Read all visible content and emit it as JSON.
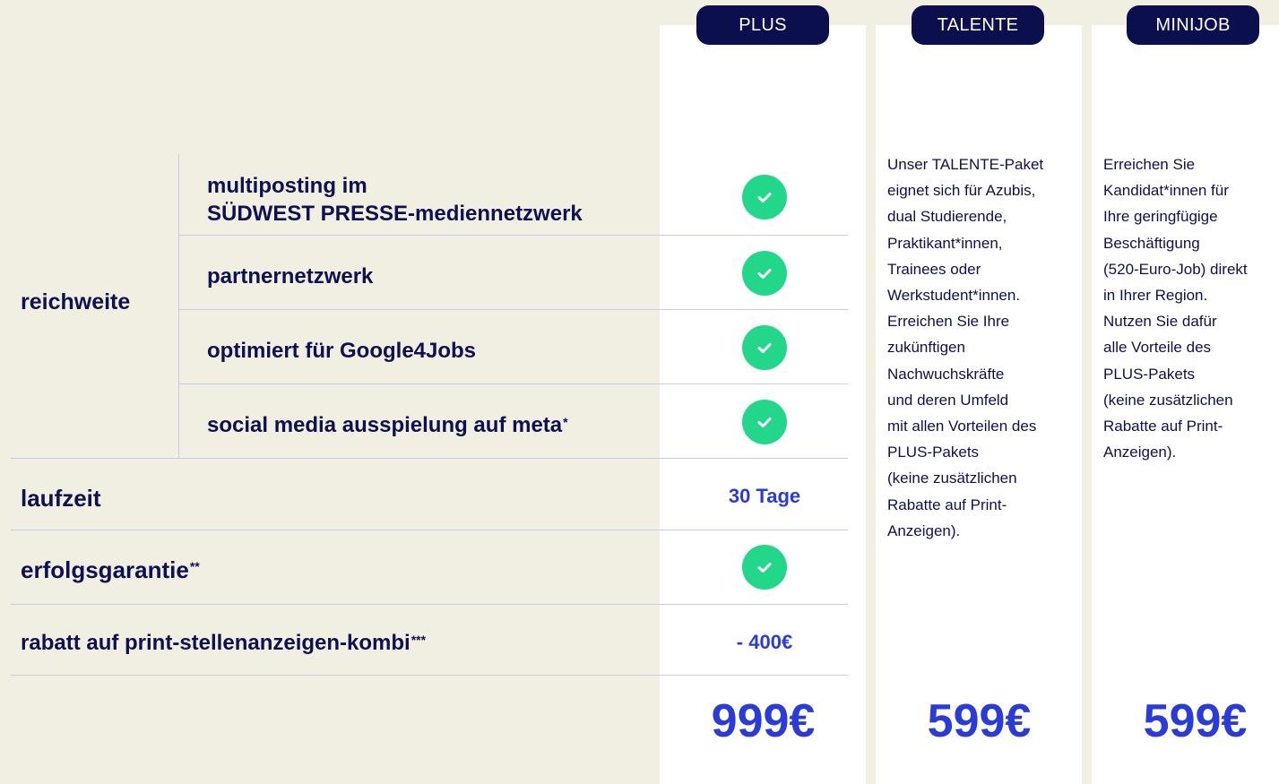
{
  "columns": {
    "plus": {
      "badge": "PLUS",
      "price": "999€"
    },
    "talente": {
      "badge": "TALENTE",
      "price": "599€",
      "description_lines": [
        "Unser TALENTE-Paket",
        "eignet sich für Azubis,",
        "dual Studierende,",
        "Praktikant*innen,",
        "Trainees oder",
        "Werkstudent*innen.",
        "Erreichen Sie Ihre",
        "zukünftigen",
        "Nachwuchskräfte",
        "und deren Umfeld",
        "mit allen Vorteilen des",
        "PLUS-Pakets",
        "(keine zusätzlichen",
        "Rabatte auf Print-",
        "Anzeigen)."
      ]
    },
    "minijob": {
      "badge": "MINIJOB",
      "price": "599€",
      "description_lines": [
        "Erreichen Sie",
        "Kandidat*innen für",
        "Ihre geringfügige",
        "Beschäftigung",
        "(520-Euro-Job) direkt",
        "in Ihrer Region.",
        "Nutzen Sie dafür",
        "alle Vorteile des",
        "PLUS-Pakets",
        "(keine zusätzlichen",
        "Rabatte auf Print-",
        "Anzeigen)."
      ]
    }
  },
  "reichweite": {
    "label": "reichweite",
    "rows": [
      {
        "label_line1": "multiposting im",
        "label_line2": "SÜDWEST PRESSE-mediennetzwerk",
        "plus_included": true
      },
      {
        "label": "partnernetzwerk",
        "plus_included": true
      },
      {
        "label": "optimiert für Google4Jobs",
        "plus_included": true
      },
      {
        "label": "social media ausspielung auf meta",
        "footnote": "*",
        "plus_included": true
      }
    ]
  },
  "laufzeit": {
    "label": "laufzeit",
    "plus_value": "30 Tage"
  },
  "erfolgsgarantie": {
    "label": "erfolgsgarantie",
    "footnote": "**",
    "plus_included": true
  },
  "rabatt": {
    "label": "rabatt auf print-stellenanzeigen-kombi",
    "footnote": "***",
    "plus_value": "- 400€"
  },
  "colors": {
    "background": "#f1eee2",
    "panel": "#ffffff",
    "navy": "#0b0f4d",
    "accent_blue": "#2a3bd6",
    "check_green": "#22d68a",
    "divider": "#c5c9ee"
  },
  "icons": {
    "included": "check-circle-icon"
  }
}
